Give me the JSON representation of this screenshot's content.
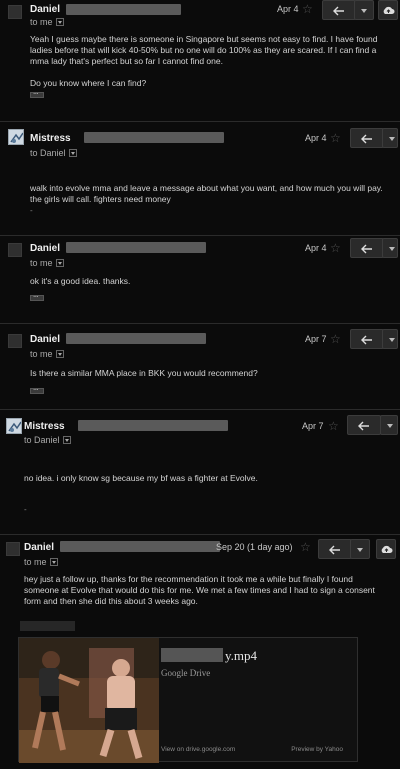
{
  "messages": [
    {
      "sender": "Daniel",
      "recipient": "to me",
      "date": "Apr 4",
      "body": "Yeah I guess maybe there is someone in Singapore but seems not easy to find. I have found ladies before that will kick 40-50% but no one will do 100% as they are scared. If I can find a mma lady that's perfect but so far I cannot find one.\n\nDo you know where I can find?",
      "has_cloud": true
    },
    {
      "sender": "Mistress",
      "recipient": "to Daniel",
      "date": "Apr 4",
      "body": "walk into evolve mma and leave a message about what you want, and how much you will pay.  the girls will call.  fighters need money",
      "signature": "-"
    },
    {
      "sender": "Daniel",
      "recipient": "to me",
      "date": "Apr 4",
      "body": "ok it's a good idea. thanks."
    },
    {
      "sender": "Daniel",
      "recipient": "to me",
      "date": "Apr 7",
      "body": "Is there a similar MMA place in BKK you would recommend?"
    },
    {
      "sender": "Mistress",
      "recipient": "to Daniel",
      "date": "Apr 7",
      "body": "no idea.  i only know sg because my bf was a fighter at Evolve.",
      "signature": "-"
    },
    {
      "sender": "Daniel",
      "recipient": "to me",
      "date": "Sep 20 (1 day ago)",
      "body": "hey just a follow up, thanks for the recommendation it took me a while but finally I found someone at Evolve that would do this for me.  We met a few times and I had to sign a consent form and then she did this about 3 weeks ago.",
      "has_cloud": true
    }
  ],
  "attachment": {
    "filename_suffix": "y.mp4",
    "source": "Google Drive",
    "view_text": "View on drive.google.com",
    "preview_text": "Preview by Yahoo"
  },
  "icons": {
    "reply": "reply-arrow-icon",
    "star": "star-icon",
    "more": "chevron-down-icon",
    "cloud": "cloud-upload-icon"
  },
  "colors": {
    "background": "#0b0b0b",
    "text": "#d8d8d8",
    "redaction": "#5a5a5a"
  }
}
